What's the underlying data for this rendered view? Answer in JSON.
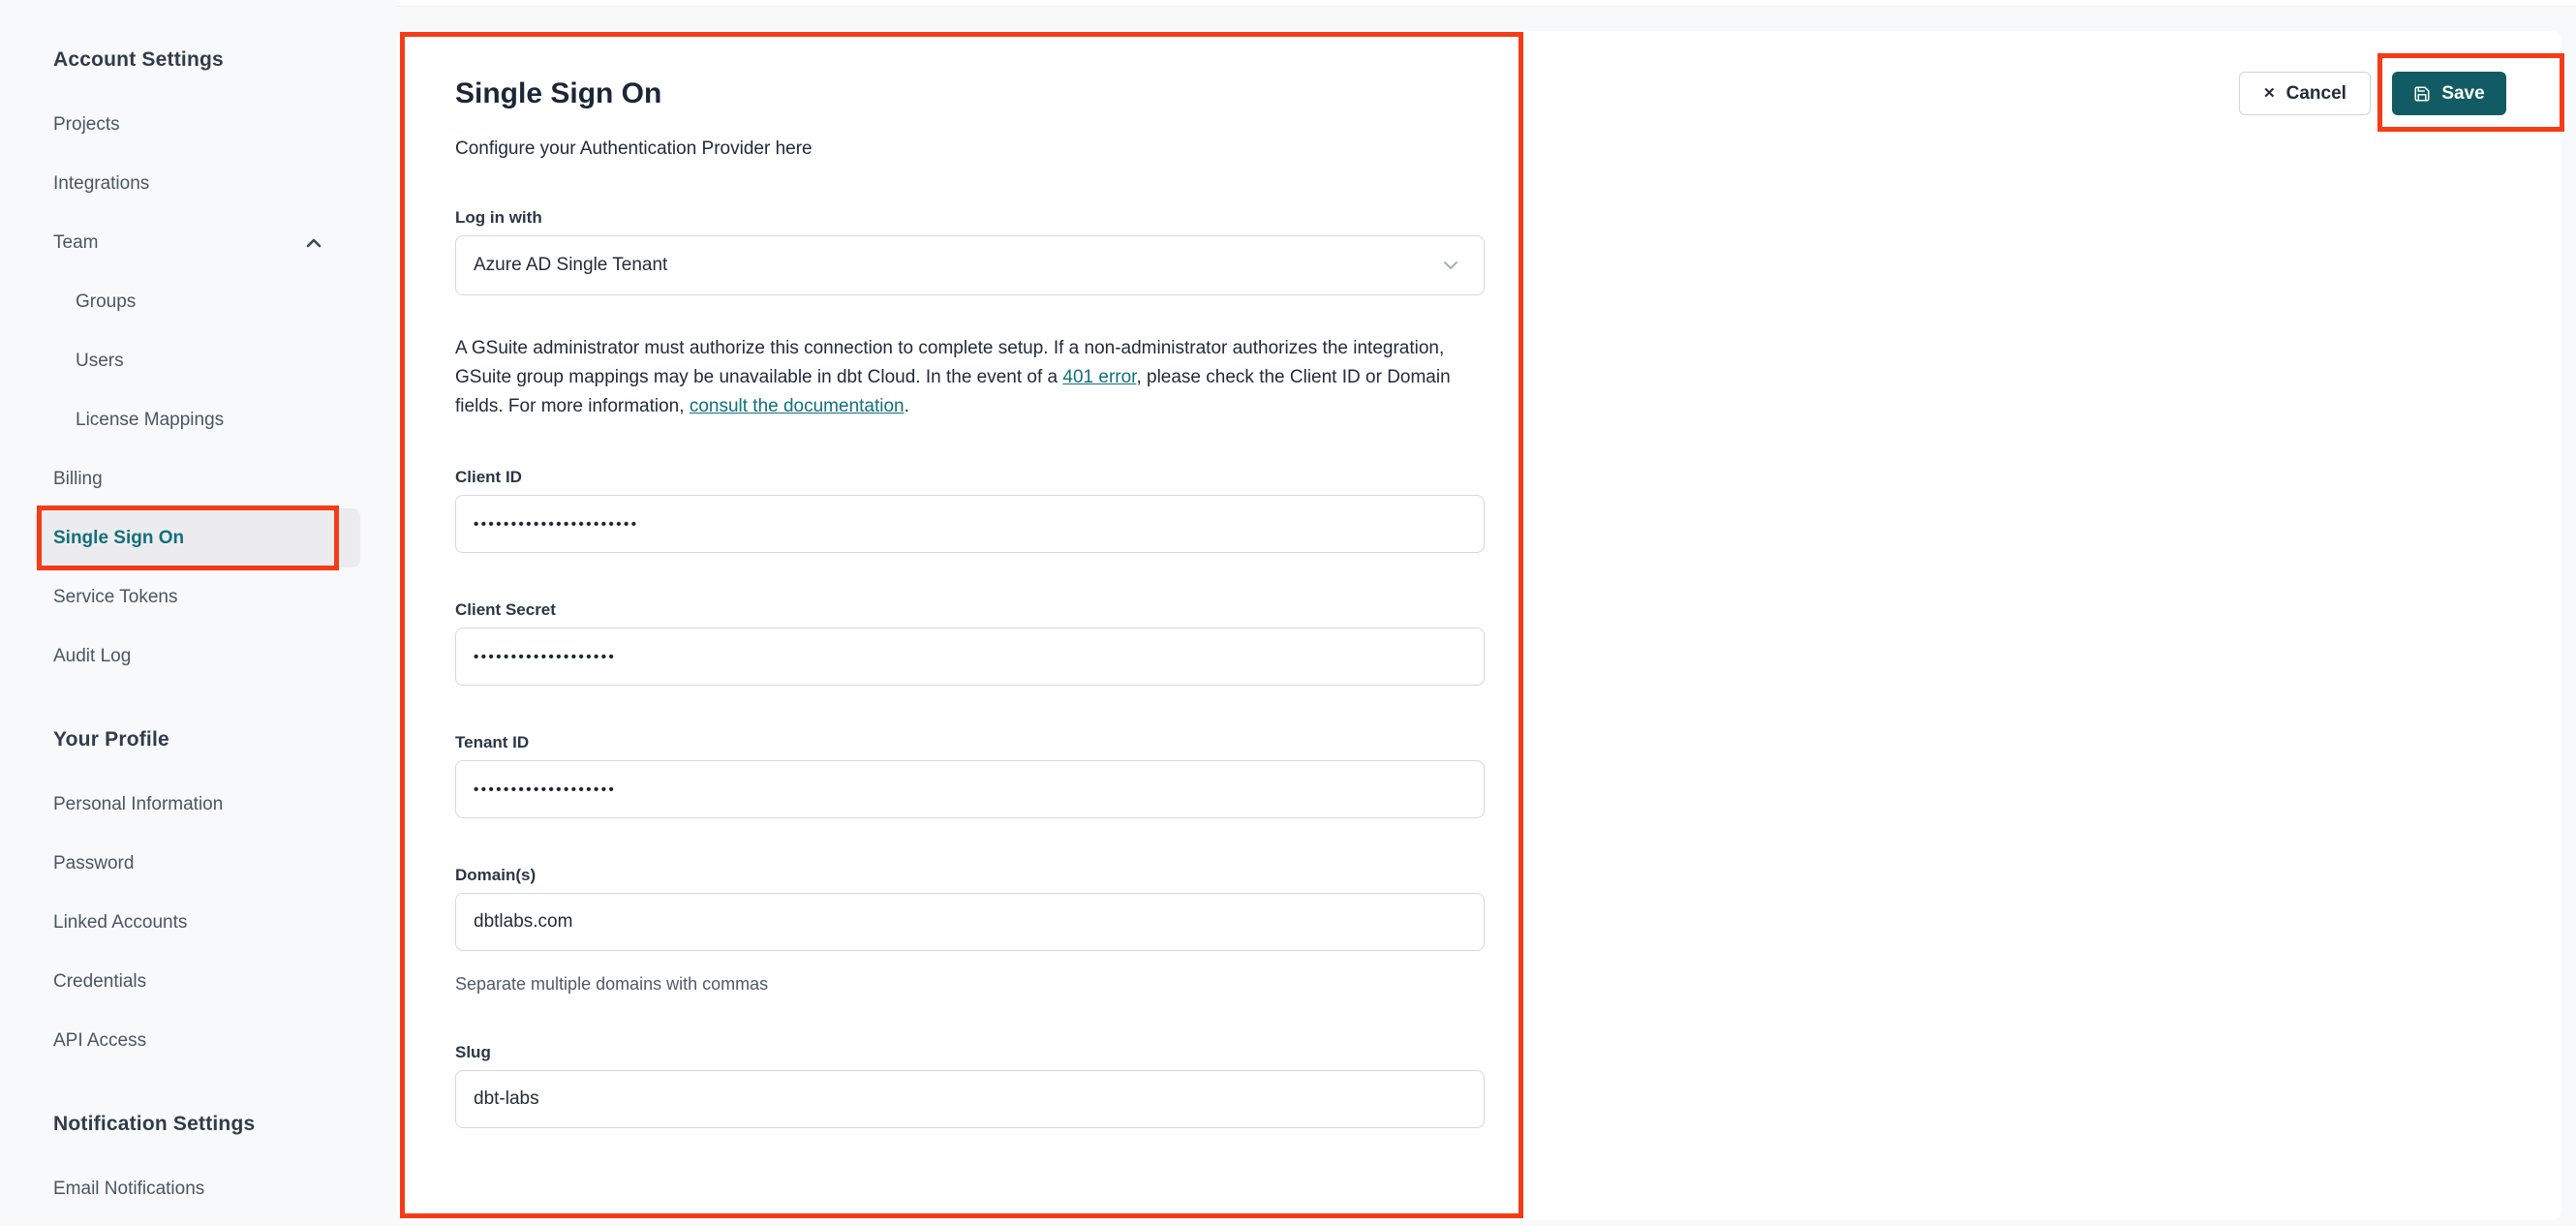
{
  "colors": {
    "annotation_red": "#f53b17",
    "accent_teal": "#11707c",
    "save_button_bg": "#115c64",
    "sidebar_bg": "#f8f9fa",
    "active_item_bg": "#ececee"
  },
  "sidebar": {
    "sections": [
      {
        "heading": "Account Settings",
        "items": [
          {
            "label": "Projects"
          },
          {
            "label": "Integrations"
          },
          {
            "label": "Team",
            "chevron": "up"
          },
          {
            "label": "Groups",
            "indent": true
          },
          {
            "label": "Users",
            "indent": true
          },
          {
            "label": "License Mappings",
            "indent": true
          },
          {
            "label": "Billing"
          },
          {
            "label": "Single Sign On",
            "active": true,
            "annotated": true
          },
          {
            "label": "Service Tokens"
          },
          {
            "label": "Audit Log"
          }
        ]
      },
      {
        "heading": "Your Profile",
        "items": [
          {
            "label": "Personal Information"
          },
          {
            "label": "Password"
          },
          {
            "label": "Linked Accounts"
          },
          {
            "label": "Credentials"
          },
          {
            "label": "API Access"
          }
        ]
      },
      {
        "heading": "Notification Settings",
        "items": [
          {
            "label": "Email Notifications"
          }
        ]
      }
    ]
  },
  "actions": {
    "cancel_label": "Cancel",
    "cancel_icon": "close-icon",
    "save_label": "Save",
    "save_icon": "floppy-disk-icon"
  },
  "main": {
    "title": "Single Sign On",
    "subtitle": "Configure your Authentication Provider here",
    "login_with": {
      "label": "Log in with",
      "value": "Azure AD Single Tenant",
      "chevron_icon": "chevron-down-icon"
    },
    "notice": {
      "part1": "A GSuite administrator must authorize this connection to complete setup. If a non-administrator authorizes the integration, GSuite group mappings may be unavailable in dbt Cloud. In the event of a ",
      "link1": "401 error",
      "part2": ", please check the Client ID or Domain fields. For more information, ",
      "link2": "consult the documentation",
      "part3": "."
    },
    "fields": [
      {
        "label": "Client ID",
        "value": "••••••••••••••••••••••",
        "masked": true
      },
      {
        "label": "Client Secret",
        "value": "•••••••••••••••••••",
        "masked": true
      },
      {
        "label": "Tenant ID",
        "value": "•••••••••••••••••••",
        "masked": true
      },
      {
        "label": "Domain(s)",
        "value": "dbtlabs.com",
        "masked": false,
        "helper": "Separate multiple domains with commas"
      },
      {
        "label": "Slug",
        "value": "dbt-labs",
        "masked": false
      }
    ]
  }
}
